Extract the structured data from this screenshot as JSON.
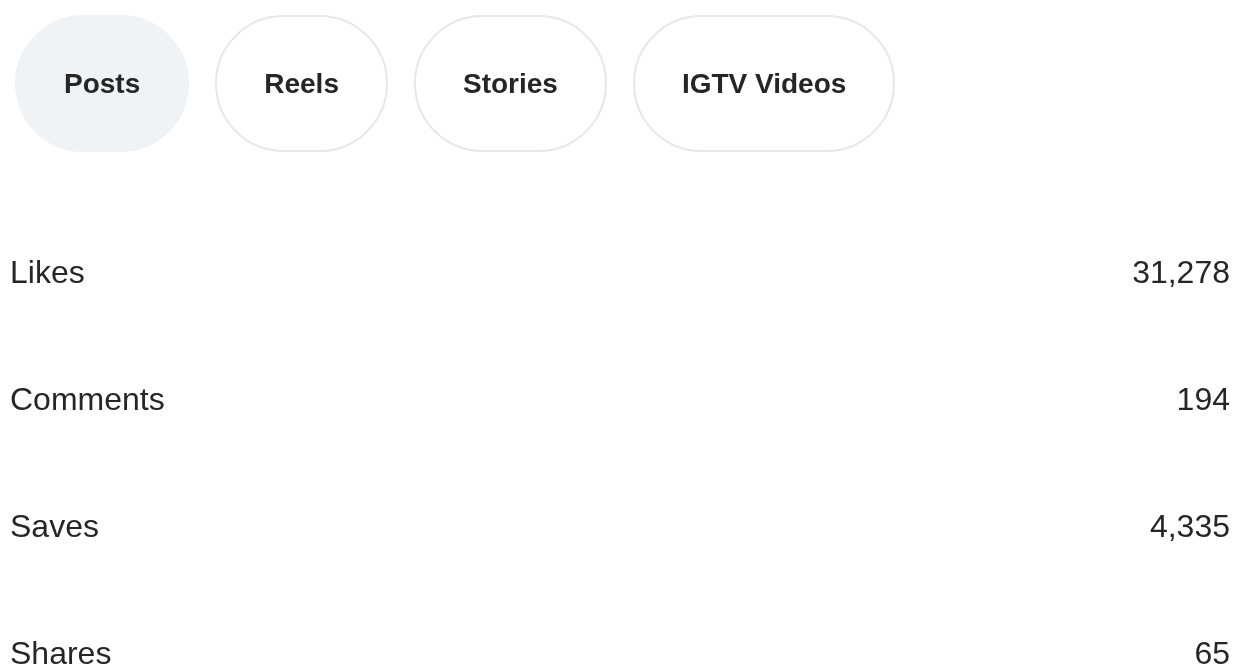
{
  "tabs": [
    {
      "label": "Posts",
      "selected": true
    },
    {
      "label": "Reels",
      "selected": false
    },
    {
      "label": "Stories",
      "selected": false
    },
    {
      "label": "IGTV Videos",
      "selected": false
    }
  ],
  "metrics": [
    {
      "label": "Likes",
      "value": "31,278"
    },
    {
      "label": "Comments",
      "value": "194"
    },
    {
      "label": "Saves",
      "value": "4,335"
    },
    {
      "label": "Shares",
      "value": "65"
    }
  ]
}
